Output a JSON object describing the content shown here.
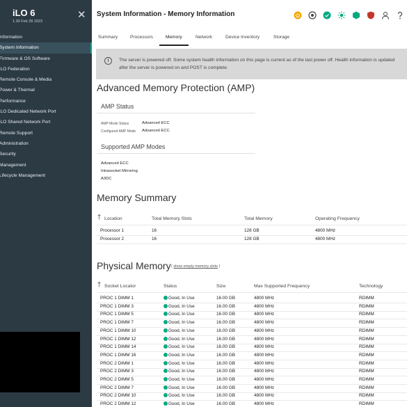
{
  "app": {
    "name": "iLO 6",
    "version": "1.30 Feb 28 2023"
  },
  "sidebar": {
    "items": [
      {
        "label": "Information"
      },
      {
        "label": "System Information",
        "active": true
      },
      {
        "label": "Firmware & OS Software"
      },
      {
        "label": "iLO Federation"
      },
      {
        "label": "Remote Console & Media"
      },
      {
        "label": "Power & Thermal"
      },
      {
        "label": "Performance"
      },
      {
        "label": "iLO Dedicated Network Port"
      },
      {
        "label": "iLO Shared Network Port"
      },
      {
        "label": "Remote Support"
      },
      {
        "label": "Administration"
      },
      {
        "label": "Security"
      },
      {
        "label": "Management"
      },
      {
        "label": "Lifecycle Management"
      }
    ]
  },
  "header": {
    "title": "System Information - Memory Information"
  },
  "header_icons": [
    {
      "name": "power-icon",
      "color": "#f0a500"
    },
    {
      "name": "target-icon",
      "color": "#444444"
    },
    {
      "name": "health-ok-icon",
      "color": "#01a982"
    },
    {
      "name": "uid-sun-icon",
      "color": "#01a982"
    },
    {
      "name": "hexagon-icon",
      "color": "#01a982"
    },
    {
      "name": "shield-icon",
      "color": "#c0392b"
    },
    {
      "name": "user-icon",
      "color": "#444444"
    },
    {
      "name": "help-icon",
      "color": "#444444"
    }
  ],
  "tabs": [
    "Summary",
    "Processors",
    "Memory",
    "Network",
    "Device Inventory",
    "Storage"
  ],
  "banner": {
    "message": "The server is powered off. Some system health information on this page is current as of the last power off. Health information is updated after the server is powered on and POST is complete."
  },
  "amp": {
    "title": "Advanced Memory Protection (AMP)",
    "status_heading": "AMP Status",
    "mode_status_label": "AMP Mode Status",
    "mode_status_value": "Advanced ECC",
    "configured_label": "Configured AMP Mode",
    "configured_value": "Advanced ECC",
    "supported_heading": "Supported AMP Modes",
    "supported_modes": [
      "Advanced ECC",
      "Intrasocket Mirroring",
      "A3DC"
    ]
  },
  "memory_summary": {
    "title": "Memory Summary",
    "columns": [
      "Location",
      "Total Memory Slots",
      "Total Memory",
      "Operating Frequency"
    ],
    "rows": [
      [
        "Processor 1",
        "16",
        "128 GB",
        "4800 MHz"
      ],
      [
        "Processor 2",
        "16",
        "128 GB",
        "4800 MHz"
      ]
    ]
  },
  "physical_memory": {
    "title": "Physical Memory",
    "show_empty_link": "show empty memory slots",
    "link_open": "(",
    "link_close": ")",
    "columns": [
      "Socket Locator",
      "Status",
      "Size",
      "Max Supported Frequency",
      "Technology"
    ],
    "rows": [
      [
        "PROC 1 DIMM 1",
        "Good, In Use",
        "16.00 GB",
        "4800 MHz",
        "RDIMM"
      ],
      [
        "PROC 1 DIMM 3",
        "Good, In Use",
        "16.00 GB",
        "4800 MHz",
        "RDIMM"
      ],
      [
        "PROC 1 DIMM 5",
        "Good, In Use",
        "16.00 GB",
        "4800 MHz",
        "RDIMM"
      ],
      [
        "PROC 1 DIMM 7",
        "Good, In Use",
        "16.00 GB",
        "4800 MHz",
        "RDIMM"
      ],
      [
        "PROC 1 DIMM 10",
        "Good, In Use",
        "16.00 GB",
        "4800 MHz",
        "RDIMM"
      ],
      [
        "PROC 1 DIMM 12",
        "Good, In Use",
        "16.00 GB",
        "4800 MHz",
        "RDIMM"
      ],
      [
        "PROC 1 DIMM 14",
        "Good, In Use",
        "16.00 GB",
        "4800 MHz",
        "RDIMM"
      ],
      [
        "PROC 1 DIMM 16",
        "Good, In Use",
        "16.00 GB",
        "4800 MHz",
        "RDIMM"
      ],
      [
        "PROC 2 DIMM 1",
        "Good, In Use",
        "16.00 GB",
        "4800 MHz",
        "RDIMM"
      ],
      [
        "PROC 2 DIMM 3",
        "Good, In Use",
        "16.00 GB",
        "4800 MHz",
        "RDIMM"
      ],
      [
        "PROC 2 DIMM 5",
        "Good, In Use",
        "16.00 GB",
        "4800 MHz",
        "RDIMM"
      ],
      [
        "PROC 2 DIMM 7",
        "Good, In Use",
        "16.00 GB",
        "4800 MHz",
        "RDIMM"
      ],
      [
        "PROC 2 DIMM 10",
        "Good, In Use",
        "16.00 GB",
        "4800 MHz",
        "RDIMM"
      ],
      [
        "PROC 2 DIMM 12",
        "Good, In Use",
        "16.00 GB",
        "4800 MHz",
        "RDIMM"
      ]
    ]
  },
  "colors": {
    "sidebar_bg": "#2c3a44",
    "accent_green": "#01a982",
    "banner_bg": "#d8d8d8"
  }
}
